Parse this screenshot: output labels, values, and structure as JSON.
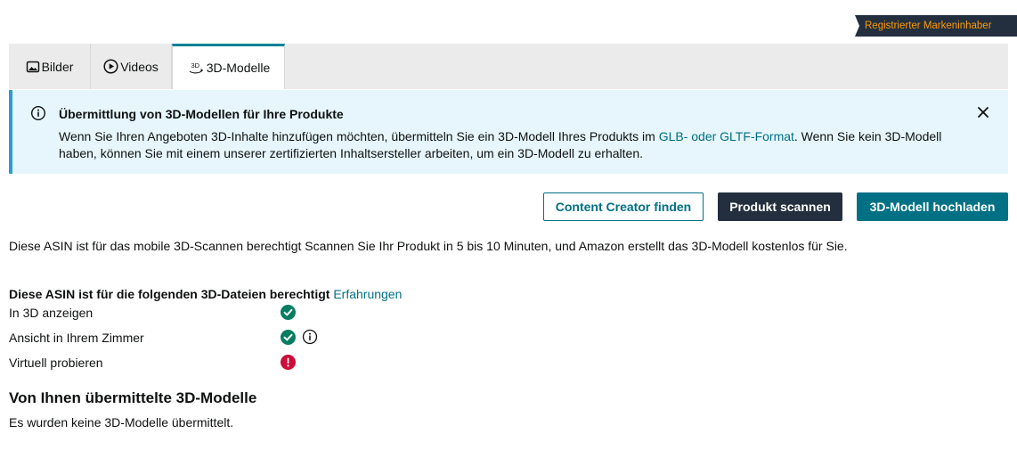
{
  "badge": {
    "label": "Registrierter Markeninhaber"
  },
  "tabs": [
    {
      "label": "Bilder",
      "icon": "image-icon",
      "active": false
    },
    {
      "label": "Videos",
      "icon": "play-circle-icon",
      "active": false
    },
    {
      "label": "3D-Modelle",
      "icon": "3d-rotate-icon",
      "icon_text": "3D",
      "active": true
    }
  ],
  "alert": {
    "title": "Übermittlung von 3D-Modellen für Ihre Produkte",
    "body_before": "Wenn Sie Ihren Angeboten 3D-Inhalte hinzufügen möchten, übermitteln Sie ein 3D-Modell Ihres Produkts im ",
    "link": "GLB- oder GLTF-Format",
    "body_after": ". Wenn Sie kein 3D-Modell haben, können Sie mit einem unserer zertifizierten Inhaltsersteller arbeiten, um ein 3D-Modell zu erhalten."
  },
  "actions": {
    "content_creator": "Content Creator finden",
    "scan": "Produkt scannen",
    "upload": "3D-Modell hochladen"
  },
  "scan_note": "Diese ASIN ist für das mobile 3D-Scannen berechtigt Scannen Sie Ihr Produkt in 5 bis 10 Minuten, und Amazon erstellt das 3D-Modell kostenlos für Sie.",
  "eligibility": {
    "heading": "Diese ASIN ist für die folgenden 3D-Dateien berechtigt",
    "link": "Erfahrungen",
    "features": [
      {
        "label": "In 3D anzeigen",
        "status": "eligible",
        "info": false
      },
      {
        "label": "Ansicht in Ihrem Zimmer",
        "status": "eligible",
        "info": true
      },
      {
        "label": "Virtuell probieren",
        "status": "not-eligible",
        "info": false
      }
    ]
  },
  "submitted": {
    "heading": "Von Ihnen übermittelte 3D-Modelle",
    "empty": "Es wurden keine 3D-Modelle übermittelt."
  },
  "colors": {
    "teal": "#007185",
    "dark": "#232f3e",
    "badge_text": "#ff9900",
    "success": "#067d62",
    "error": "#cc0c39",
    "alert_bg": "#e6f6fc"
  }
}
